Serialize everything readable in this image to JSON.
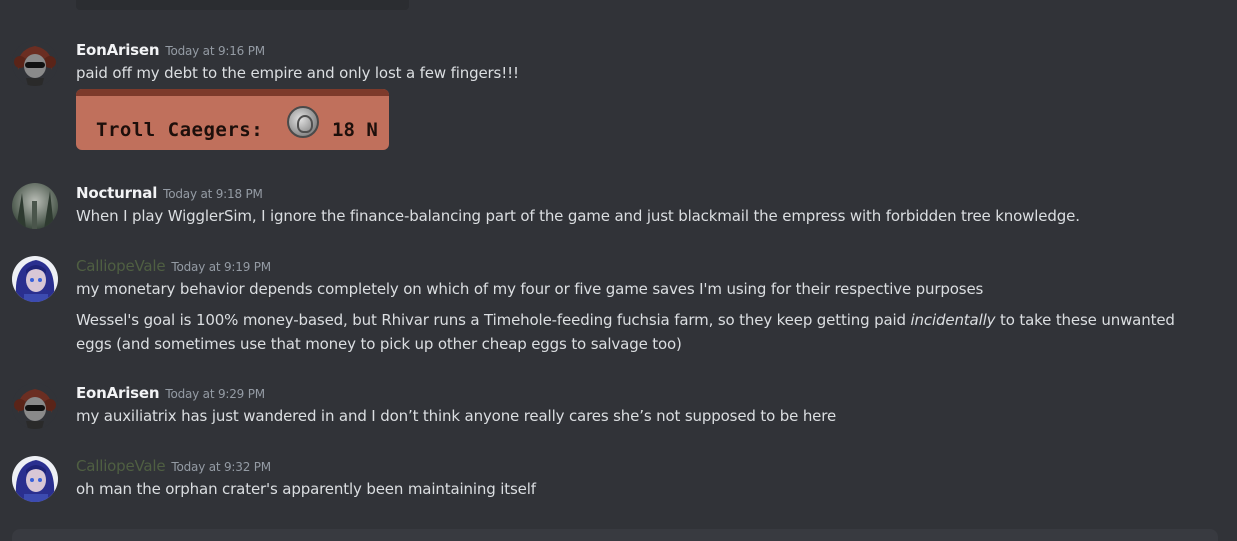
{
  "messages": [
    {
      "username": "EonArisen",
      "timestamp": "Today at 9:16 PM",
      "lines": [
        "paid off my debt to the empire and only lost a few fingers!!!"
      ],
      "embed": {
        "label": "Troll Caegers:",
        "amount": "18 N",
        "icon": "caeger-coin-icon"
      }
    },
    {
      "username": "Nocturnal",
      "timestamp": "Today at 9:18 PM",
      "lines": [
        "When I play WigglerSim, I ignore the finance-balancing part of the game and just blackmail the empress with forbidden tree knowledge."
      ]
    },
    {
      "username": "CalliopeVale",
      "timestamp": "Today at 9:19 PM",
      "lines": [
        "my monetary behavior depends completely on which of my four or five game saves I'm using for their respective purposes",
        {
          "before": "Wessel's goal is 100% money-based, but Rhivar runs a Timehole-feeding fuchsia farm, so they keep getting paid ",
          "italic": "incidentally",
          "after": " to take these unwanted eggs (and sometimes use that money to pick up other cheap eggs to salvage too)"
        }
      ]
    },
    {
      "username": "EonArisen",
      "timestamp": "Today at 9:29 PM",
      "lines": [
        "my auxiliatrix has just wandered in and I don’t think anyone really cares she’s not supposed to be here"
      ]
    },
    {
      "username": "CalliopeVale",
      "timestamp": "Today at 9:32 PM",
      "lines": [
        "oh man the orphan crater's apparently been maintaining itself"
      ]
    }
  ],
  "colors": {
    "background": "#313338",
    "username_default": "#f2f3f5",
    "username_calliope": "#4f5f42",
    "timestamp": "#949ba4",
    "text": "#dbdee1"
  }
}
